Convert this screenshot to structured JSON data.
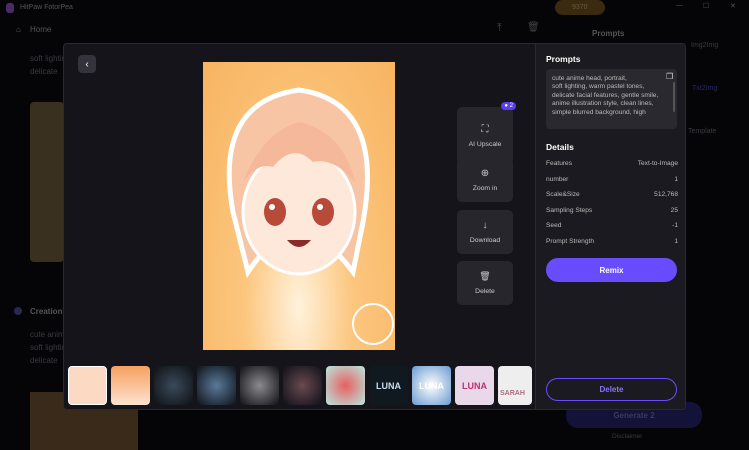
{
  "app": {
    "title": "HitPaw FotorPea",
    "credits": "9370",
    "home": "Home"
  },
  "background": {
    "text_lines": [
      "soft lighting,",
      "delicate"
    ],
    "creation_label": "Creation",
    "creation_lines": [
      "cute anime",
      "soft lighting,",
      "delicate"
    ],
    "right_title": "Prompts",
    "nav": [
      "Img2Img",
      "Txt2Img",
      "Template"
    ],
    "generate": "Generate",
    "generate_cost": "2",
    "disclaimer": "Disclaimer"
  },
  "modal": {
    "actions": [
      {
        "label": "AI Upscale",
        "icon": "upscale-icon",
        "badge": "2"
      },
      {
        "label": "Zoom in",
        "icon": "zoom-in-icon"
      },
      {
        "label": "Download",
        "icon": "download-icon"
      },
      {
        "label": "Delete",
        "icon": "trash-icon"
      }
    ],
    "thumbnails": [
      "anime girl 1",
      "anime girl 2",
      "black panther",
      "glass wolf",
      "white wolf",
      "lion",
      "flower bouquet",
      "LUNA",
      "LUNA",
      "LUNA",
      "SARAH"
    ],
    "thumb_texts": {
      "t7": "LUNA",
      "t8": "LUNA",
      "t9": "LUNA",
      "t10": "SARAH"
    }
  },
  "panel": {
    "prompts_title": "Prompts",
    "prompt_text": "cute anime head, portrait,\nsoft lighting, warm pastel tones,\ndelicate facial features, gentle smile,\nanime illustration style, clean lines,\nsimple blurred background, high",
    "details_title": "Details",
    "details": [
      {
        "k": "Features",
        "v": "Text-to-Image"
      },
      {
        "k": "number",
        "v": "1"
      },
      {
        "k": "Scale&Size",
        "v": "512,768"
      },
      {
        "k": "Sampling Steps",
        "v": "25"
      },
      {
        "k": "Seed",
        "v": "-1"
      },
      {
        "k": "Prompt Strength",
        "v": "1"
      }
    ],
    "remix": "Remix",
    "delete": "Delete"
  },
  "colors": {
    "accent": "#6a4cff"
  }
}
